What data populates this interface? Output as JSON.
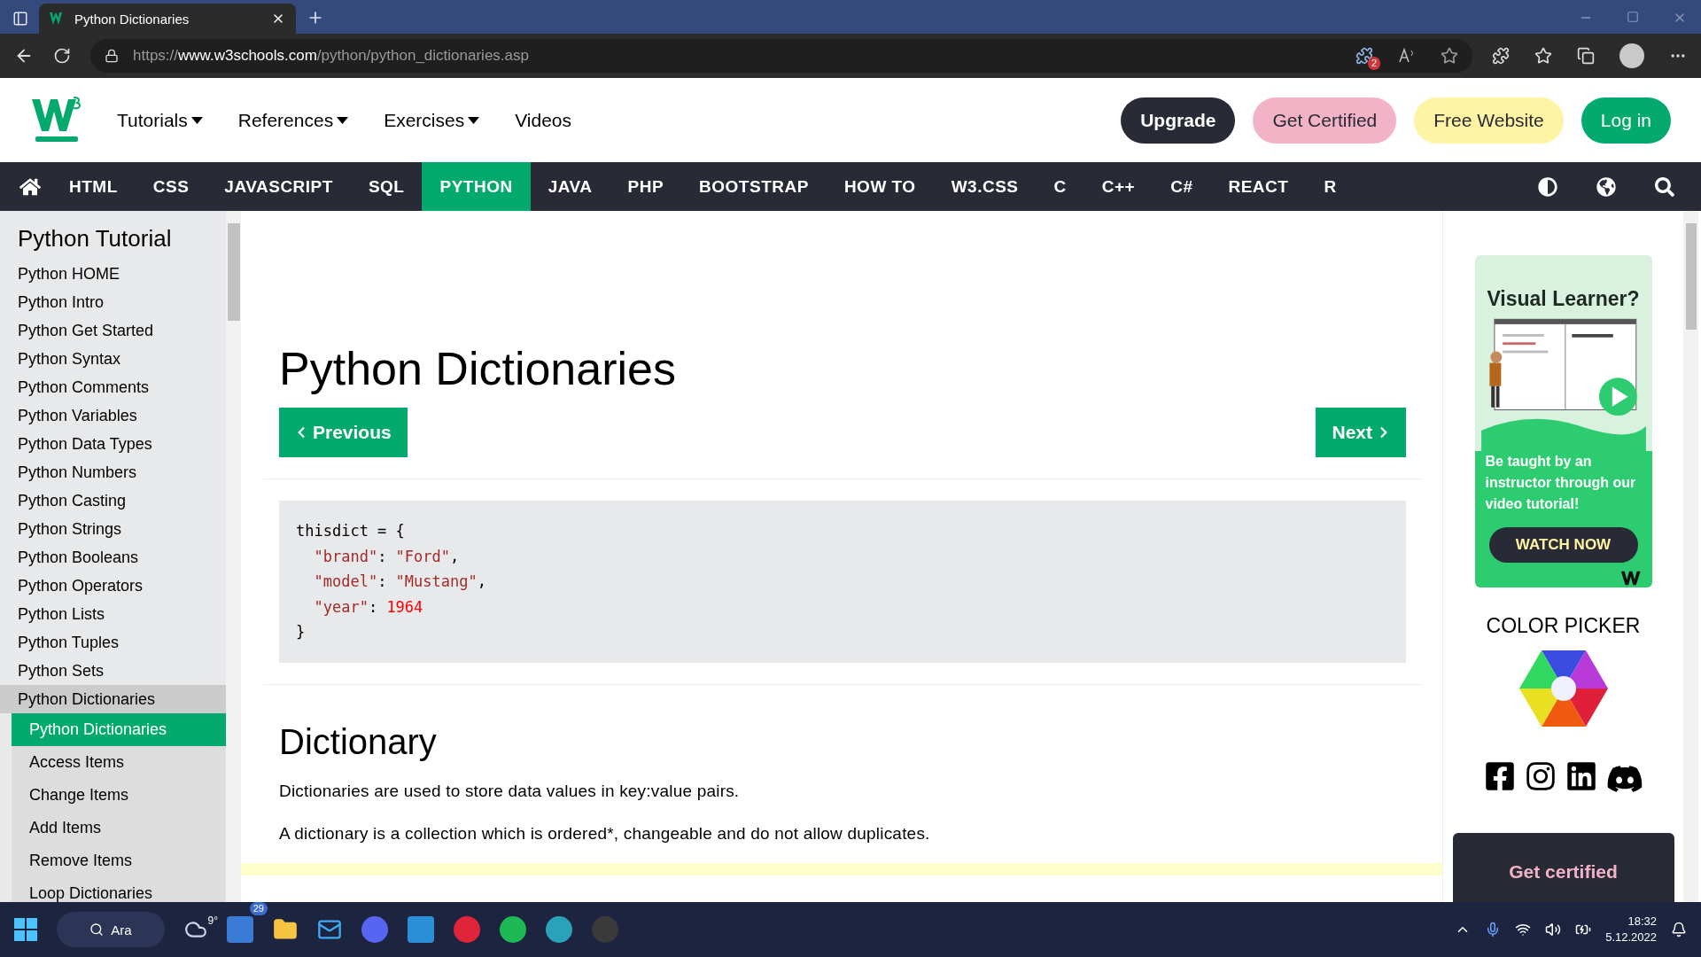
{
  "browser": {
    "tab_title": "Python Dictionaries",
    "url": {
      "scheme": "https://",
      "host": "www.w3schools.com",
      "path": "/python/python_dictionaries.asp"
    },
    "extension_badge": "2"
  },
  "header": {
    "menus": [
      {
        "label": "Tutorials",
        "dropdown": true
      },
      {
        "label": "References",
        "dropdown": true
      },
      {
        "label": "Exercises",
        "dropdown": true
      },
      {
        "label": "Videos",
        "dropdown": false
      }
    ],
    "buttons": [
      {
        "label": "Upgrade",
        "kind": "upgrade"
      },
      {
        "label": "Get Certified",
        "kind": "certified"
      },
      {
        "label": "Free Website",
        "kind": "website"
      },
      {
        "label": "Log in",
        "kind": "login"
      }
    ]
  },
  "topnav": {
    "items": [
      {
        "label": "HTML",
        "selected": false
      },
      {
        "label": "CSS",
        "selected": false
      },
      {
        "label": "JAVASCRIPT",
        "selected": false
      },
      {
        "label": "SQL",
        "selected": false
      },
      {
        "label": "PYTHON",
        "selected": true
      },
      {
        "label": "JAVA",
        "selected": false
      },
      {
        "label": "PHP",
        "selected": false
      },
      {
        "label": "BOOTSTRAP",
        "selected": false
      },
      {
        "label": "HOW TO",
        "selected": false
      },
      {
        "label": "W3.CSS",
        "selected": false
      },
      {
        "label": "C",
        "selected": false
      },
      {
        "label": "C++",
        "selected": false
      },
      {
        "label": "C#",
        "selected": false
      },
      {
        "label": "REACT",
        "selected": false
      },
      {
        "label": "R",
        "selected": false
      }
    ]
  },
  "sidebar": {
    "title": "Python Tutorial",
    "items": [
      {
        "label": "Python HOME",
        "selected": false
      },
      {
        "label": "Python Intro",
        "selected": false
      },
      {
        "label": "Python Get Started",
        "selected": false
      },
      {
        "label": "Python Syntax",
        "selected": false
      },
      {
        "label": "Python Comments",
        "selected": false
      },
      {
        "label": "Python Variables",
        "selected": false
      },
      {
        "label": "Python Data Types",
        "selected": false
      },
      {
        "label": "Python Numbers",
        "selected": false
      },
      {
        "label": "Python Casting",
        "selected": false
      },
      {
        "label": "Python Strings",
        "selected": false
      },
      {
        "label": "Python Booleans",
        "selected": false
      },
      {
        "label": "Python Operators",
        "selected": false
      },
      {
        "label": "Python Lists",
        "selected": false
      },
      {
        "label": "Python Tuples",
        "selected": false
      },
      {
        "label": "Python Sets",
        "selected": false
      },
      {
        "label": "Python Dictionaries",
        "selected": false,
        "expanded": true,
        "children": [
          {
            "label": "Python Dictionaries",
            "selected": true
          },
          {
            "label": "Access Items",
            "selected": false
          },
          {
            "label": "Change Items",
            "selected": false
          },
          {
            "label": "Add Items",
            "selected": false
          },
          {
            "label": "Remove Items",
            "selected": false
          },
          {
            "label": "Loop Dictionaries",
            "selected": false
          }
        ]
      }
    ]
  },
  "main": {
    "title": "Python Dictionaries",
    "previous": "Previous",
    "next": "Next",
    "code": [
      [
        {
          "text": "thisdict = {",
          "kind": "plain"
        }
      ],
      [
        {
          "text": "  \"brand\"",
          "kind": "string"
        },
        {
          "text": ": ",
          "kind": "plain"
        },
        {
          "text": "\"Ford\"",
          "kind": "string"
        },
        {
          "text": ",",
          "kind": "plain"
        }
      ],
      [
        {
          "text": "  \"model\"",
          "kind": "string"
        },
        {
          "text": ": ",
          "kind": "plain"
        },
        {
          "text": "\"Mustang\"",
          "kind": "string"
        },
        {
          "text": ",",
          "kind": "plain"
        }
      ],
      [
        {
          "text": "  \"year\"",
          "kind": "string"
        },
        {
          "text": ": ",
          "kind": "plain"
        },
        {
          "text": "1964",
          "kind": "number"
        }
      ],
      [
        {
          "text": "}",
          "kind": "plain"
        }
      ]
    ],
    "heading": "Dictionary",
    "paragraphs": [
      "Dictionaries are used to store data values in key:value pairs.",
      "A dictionary is a collection which is ordered*, changeable and do not allow duplicates."
    ]
  },
  "right": {
    "ad": {
      "title": "Visual Learner?",
      "text": "Be taught by an instructor through our video tutorial!",
      "button": "WATCH NOW"
    },
    "color_picker": "COLOR PICKER",
    "cta": "Get certified"
  },
  "taskbar": {
    "search": "Ara",
    "weather": "9°",
    "widget_badge": "29",
    "time": "18:32",
    "date": "5.12.2022"
  }
}
